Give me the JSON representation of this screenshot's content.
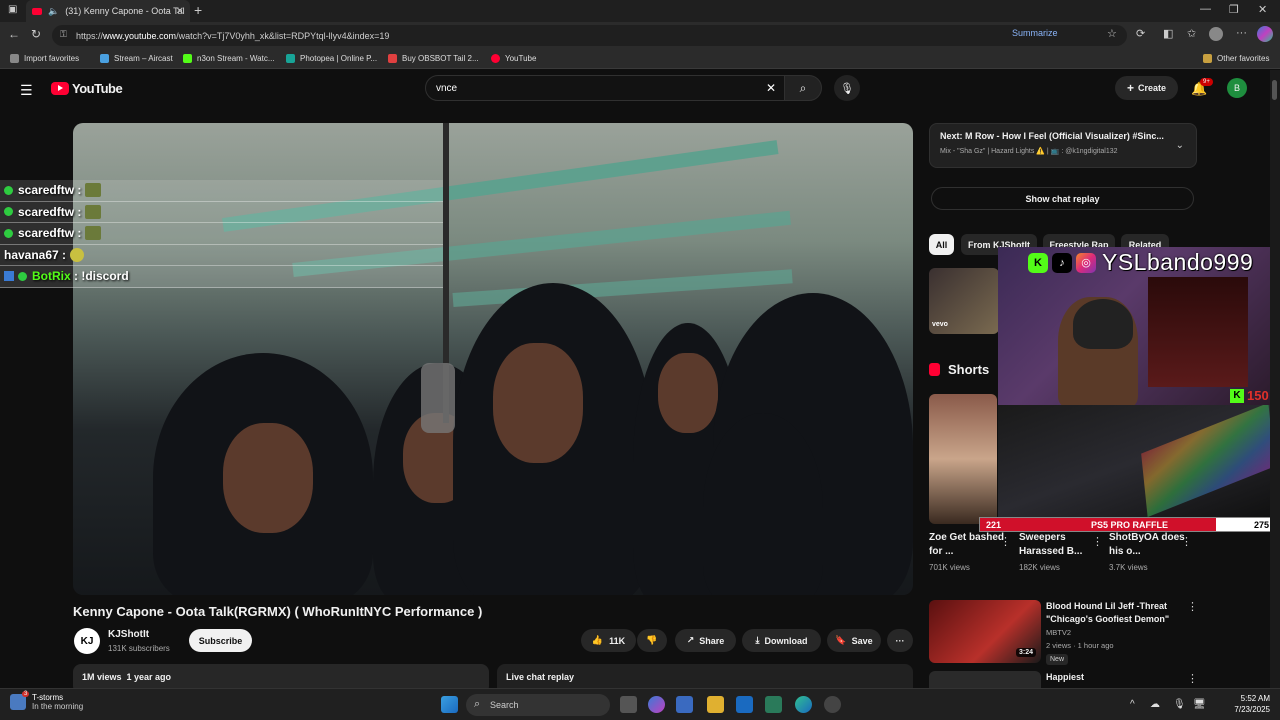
{
  "browser": {
    "tab_title": "(31) Kenny Capone - Oota Tal",
    "url_prefix": "https://",
    "url_host": "www.youtube.com",
    "url_path": "/watch?v=Tj7V0yhh_xk&list=RDPYtql-llyv4&index=19",
    "summarize_label": "Summarize",
    "bookmarks": [
      {
        "label": "Import favorites",
        "color": "#aaaaaa"
      },
      {
        "label": "Stream – Aircast",
        "color": "#4aa0e0"
      },
      {
        "label": "n3on Stream - Watc...",
        "color": "#53fc18"
      },
      {
        "label": "Photopea | Online P...",
        "color": "#18a497"
      },
      {
        "label": "Buy OBSBOT Tail 2...",
        "color": "#e04040"
      },
      {
        "label": "YouTube",
        "color": "#ff0033"
      }
    ],
    "other_favorites": "Other favorites"
  },
  "youtube": {
    "logo_text": "YouTube",
    "search_value": "vnce",
    "create_label": "Create",
    "notif_badge": "9+",
    "avatar_letter": "B"
  },
  "chat_overlay": [
    {
      "user": "scaredftw",
      "msg": "",
      "check": true,
      "bot": false
    },
    {
      "user": "scaredftw",
      "msg": "",
      "check": true,
      "bot": false
    },
    {
      "user": "scaredftw",
      "msg": "",
      "check": true,
      "bot": false
    },
    {
      "user": "havana67",
      "msg": "",
      "check": false,
      "bot": false
    },
    {
      "user": "BotRix",
      "msg": "!discord",
      "check": true,
      "bot": true
    }
  ],
  "video": {
    "title": "Kenny Capone - Oota Talk(RGRMX) ( WhoRunItNYC Performance )",
    "channel": "KJShotIt",
    "channel_avatar": "KJ",
    "subscribers": "131K subscribers",
    "subscribe_label": "Subscribe",
    "likes": "11K",
    "share_label": "Share",
    "download_label": "Download",
    "save_label": "Save",
    "more_label": "···",
    "views_date": "1M views  1 year ago",
    "live_chat_label": "Live chat replay"
  },
  "sidebar": {
    "next_title": "Next: M Row - How I Feel (Official Visualizer) #Sinc...",
    "next_sub": "Mix - \"Sha Gz\" | Hazard Lights ⚠️ | 📺 : @k1ngdigital132",
    "show_chat_replay": "Show chat replay",
    "chips": [
      "All",
      "From KJShotIt",
      "Freestyle Rap",
      "Related"
    ],
    "vevo": "vevo",
    "shorts_heading": "Shorts",
    "shorts": [
      {
        "title": "Zoe Get bashed for ...",
        "views": "701K views"
      },
      {
        "title": "Sweepers Harassed B...",
        "views": "182K views"
      },
      {
        "title": "ShotByOA does his o...",
        "views": "3.7K views"
      }
    ],
    "rec2": {
      "title": "Blood Hound Lil Jeff -Threat \"Chicago's Goofiest Demon\"",
      "channel": "MBTV2",
      "meta": "2 views · 1 hour ago",
      "badge": "New",
      "duration": "3:24"
    },
    "rec3": {
      "title": "Happiest"
    }
  },
  "stream_overlay": {
    "handle": "YSLbando999",
    "k_count": "150",
    "raffle_left": "221",
    "raffle_label": "PS5 PRO RAFFLE",
    "raffle_right": "275",
    "raffle_progress": 0.8
  },
  "taskbar": {
    "weather_title": "T-storms",
    "weather_sub": "In the morning",
    "weather_badge": "3",
    "search_placeholder": "Search",
    "time": "5:52 AM",
    "date": "7/23/2025"
  }
}
